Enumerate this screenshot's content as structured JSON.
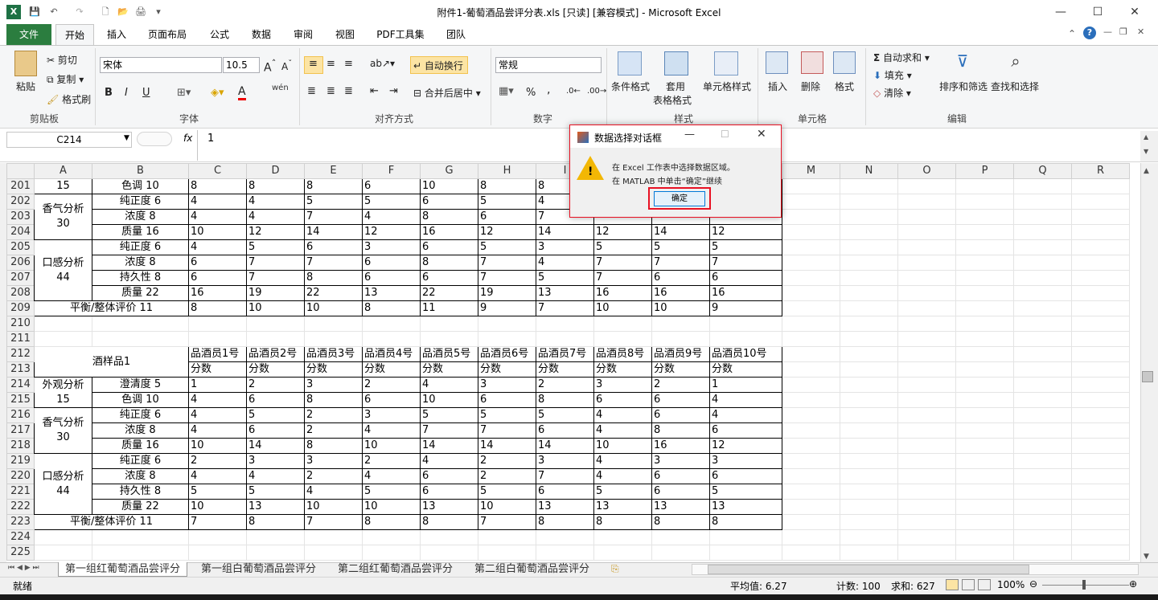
{
  "window": {
    "title": "附件1-葡萄酒品尝评分表.xls  [只读]  [兼容模式] - Microsoft Excel",
    "min": "—",
    "max": "☐",
    "close": "✕"
  },
  "qat": {
    "excel_icon": "X",
    "save": "💾",
    "undo": "↶",
    "redo": "↷",
    "new": "🗋",
    "open": "📂",
    "print": "🖨"
  },
  "tabs": [
    "文件",
    "开始",
    "插入",
    "页面布局",
    "公式",
    "数据",
    "审阅",
    "视图",
    "PDF工具集",
    "团队"
  ],
  "ribbon": {
    "clipboard": {
      "paste": "粘贴",
      "cut": "剪切",
      "copy": "复制",
      "format_painter": "格式刷",
      "label": "剪贴板"
    },
    "font": {
      "name": "宋体",
      "size": "10.5",
      "bold": "B",
      "italic": "I",
      "underline": "U",
      "label": "字体",
      "phonetic": "wén"
    },
    "align": {
      "wrap": "自动换行",
      "merge": "合并后居中",
      "label": "对齐方式"
    },
    "number": {
      "format": "常规",
      "percent": "%",
      "comma": ",",
      "label": "数字"
    },
    "styles": {
      "cond": "条件格式",
      "table1": "套用",
      "table2": "表格格式",
      "cell": "单元格样式",
      "label": "样式"
    },
    "cells": {
      "insert": "插入",
      "delete": "删除",
      "format": "格式",
      "label": "单元格"
    },
    "editing": {
      "autosum": "自动求和",
      "fill": "填充",
      "clear": "清除",
      "sort": "排序和筛选",
      "find": "查找和选择",
      "label": "编辑"
    }
  },
  "formula": {
    "namebox": "C214",
    "fx": "fx",
    "value": "1"
  },
  "columns": [
    "A",
    "B",
    "C",
    "D",
    "E",
    "F",
    "G",
    "H",
    "I",
    "J",
    "K",
    "L",
    "M",
    "N",
    "O",
    "P",
    "Q",
    "R"
  ],
  "rows": {
    "r201": {
      "n": "201",
      "a": "15",
      "b": "色调   10",
      "v": [
        "8",
        "8",
        "8",
        "6",
        "10",
        "8",
        "8",
        "",
        "",
        ""
      ]
    },
    "r202": {
      "n": "202",
      "b": "纯正度   6",
      "v": [
        "4",
        "4",
        "5",
        "5",
        "6",
        "5",
        "4",
        "",
        "",
        ""
      ]
    },
    "r203": {
      "n": "203",
      "b": "浓度   8",
      "v": [
        "4",
        "4",
        "7",
        "4",
        "8",
        "6",
        "7",
        "",
        "",
        ""
      ]
    },
    "r204": {
      "n": "204",
      "b": "质量   16",
      "v": [
        "10",
        "12",
        "14",
        "12",
        "16",
        "12",
        "14",
        "12",
        "14",
        "12"
      ]
    },
    "r205": {
      "n": "205",
      "b": "纯正度   6",
      "v": [
        "4",
        "5",
        "6",
        "3",
        "6",
        "5",
        "3",
        "5",
        "5",
        "5"
      ]
    },
    "r206": {
      "n": "206",
      "b": "浓度   8",
      "v": [
        "6",
        "7",
        "7",
        "6",
        "8",
        "7",
        "4",
        "7",
        "7",
        "7"
      ]
    },
    "r207": {
      "n": "207",
      "b": "持久性  8",
      "v": [
        "6",
        "7",
        "8",
        "6",
        "6",
        "7",
        "5",
        "7",
        "6",
        "6"
      ]
    },
    "r208": {
      "n": "208",
      "b": "质量  22",
      "v": [
        "16",
        "19",
        "22",
        "13",
        "22",
        "19",
        "13",
        "16",
        "16",
        "16"
      ]
    },
    "r209": {
      "n": "209",
      "ab": "平衡/整体评价  11",
      "v": [
        "8",
        "10",
        "10",
        "8",
        "11",
        "9",
        "7",
        "10",
        "10",
        "9"
      ]
    },
    "r210": {
      "n": "210"
    },
    "r211": {
      "n": "211"
    },
    "r212": {
      "n": "212",
      "hdr": [
        "品酒员1号",
        "品酒员2号",
        "品酒员3号",
        "品酒员4号",
        "品酒员5号",
        "品酒员6号",
        "品酒员7号",
        "品酒员8号",
        "品酒员9号",
        "品酒员10号"
      ]
    },
    "r213": {
      "n": "213",
      "sub": "分数"
    },
    "r214": {
      "n": "214",
      "b": "澄清度   5",
      "v": [
        "1",
        "2",
        "3",
        "2",
        "4",
        "3",
        "2",
        "3",
        "2",
        "1"
      ]
    },
    "r215": {
      "n": "215",
      "b": "色调   10",
      "v": [
        "4",
        "6",
        "8",
        "6",
        "10",
        "6",
        "8",
        "6",
        "6",
        "4"
      ]
    },
    "r216": {
      "n": "216",
      "b": "纯正度   6",
      "v": [
        "4",
        "5",
        "2",
        "3",
        "5",
        "5",
        "5",
        "4",
        "6",
        "4"
      ]
    },
    "r217": {
      "n": "217",
      "b": "浓度   8",
      "v": [
        "4",
        "6",
        "2",
        "4",
        "7",
        "7",
        "6",
        "4",
        "8",
        "6"
      ]
    },
    "r218": {
      "n": "218",
      "b": "质量   16",
      "v": [
        "10",
        "14",
        "8",
        "10",
        "14",
        "14",
        "14",
        "10",
        "16",
        "12"
      ]
    },
    "r219": {
      "n": "219",
      "b": "纯正度   6",
      "v": [
        "2",
        "3",
        "3",
        "2",
        "4",
        "2",
        "3",
        "4",
        "3",
        "3"
      ]
    },
    "r220": {
      "n": "220",
      "b": "浓度   8",
      "v": [
        "4",
        "4",
        "2",
        "4",
        "6",
        "2",
        "7",
        "4",
        "6",
        "6"
      ]
    },
    "r221": {
      "n": "221",
      "b": "持久性  8",
      "v": [
        "5",
        "5",
        "4",
        "5",
        "6",
        "5",
        "6",
        "5",
        "6",
        "5"
      ]
    },
    "r222": {
      "n": "222",
      "b": "质量  22",
      "v": [
        "10",
        "13",
        "10",
        "10",
        "13",
        "10",
        "13",
        "13",
        "13",
        "13"
      ]
    },
    "r223": {
      "n": "223",
      "ab": "平衡/整体评价  11",
      "v": [
        "7",
        "8",
        "7",
        "8",
        "8",
        "7",
        "8",
        "8",
        "8",
        "8"
      ]
    },
    "r224": {
      "n": "224"
    },
    "r225": {
      "n": "225"
    }
  },
  "groups": {
    "aroma": "香气分析",
    "aroma_n": "30",
    "taste": "口感分析",
    "taste_n": "44",
    "look": "外观分析",
    "look_n": "15",
    "sample": "酒样品1"
  },
  "sheets": [
    "第一组红葡萄酒品尝评分",
    "第一组白葡萄酒品尝评分",
    "第二组红葡萄酒品尝评分",
    "第二组白葡萄酒品尝评分"
  ],
  "status": {
    "ready": "就绪",
    "avg": "平均值: 6.27",
    "count": "计数: 100",
    "sum": "求和: 627",
    "zoom": "100%"
  },
  "dialog": {
    "title": "数据选择对话框",
    "line1": "在 Excel 工作表中选择数据区域。",
    "line2": "在 MATLAB 中单击“确定”继续",
    "ok": "确定"
  }
}
